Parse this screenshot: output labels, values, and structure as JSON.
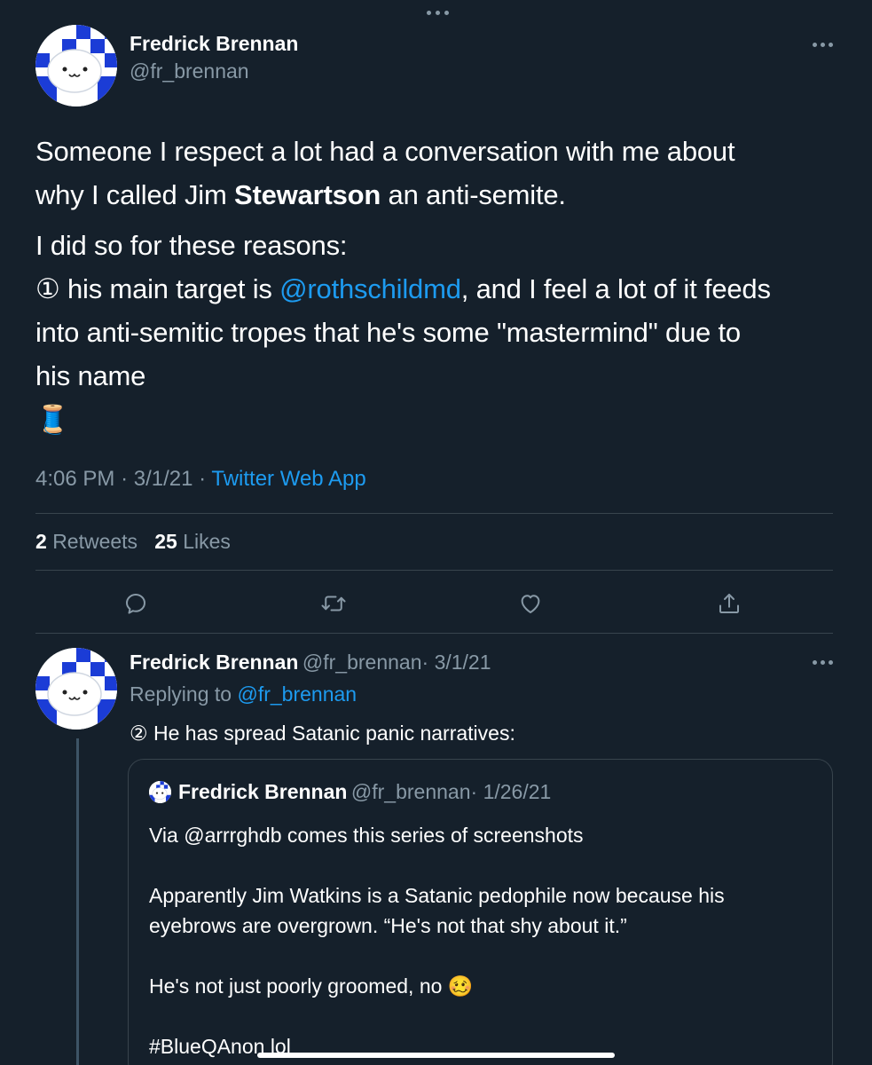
{
  "main_tweet": {
    "author_name": "Fredrick Brennan",
    "author_handle": "@fr_brennan",
    "line1": "Someone I respect a lot had a conversation with me about",
    "line2_pre": "why I called Jim ",
    "line2_bold": "Stewartson",
    "line2_post": " an anti-semite.",
    "para2_line1": "I did so for these reasons:",
    "para2_line2_pre": "① his main target is ",
    "para2_mention": "@rothschildmd",
    "para2_line2_post": ", and I feel a lot of it feeds",
    "para2_line3": "into anti-semitic tropes that he's some \"mastermind\" due to",
    "para2_line4": "his name",
    "thread_emoji": "🧵",
    "time": "4:06 PM",
    "date": "3/1/21",
    "separator": "·",
    "source": "Twitter Web App",
    "retweets_count": "2",
    "retweets_label": "Retweets",
    "likes_count": "25",
    "likes_label": "Likes"
  },
  "actions": {
    "reply_icon": "reply-icon",
    "retweet_icon": "retweet-icon",
    "like_icon": "heart-icon",
    "share_icon": "share-icon"
  },
  "reply_tweet": {
    "author_name": "Fredrick Brennan",
    "author_handle": "@fr_brennan",
    "date": "· 3/1/21",
    "replying_to_label": "Replying to",
    "replying_to_handle": "@fr_brennan",
    "text": "② He has spread Satanic panic narratives:"
  },
  "quoted_tweet": {
    "author_name": "Fredrick Brennan",
    "author_handle": "@fr_brennan",
    "date": "· 1/26/21",
    "line1": "Via @arrrghdb comes this series of screenshots",
    "line2": "Apparently Jim Watkins is a Satanic pedophile now because his",
    "line3": "eyebrows are overgrown. “He's not that shy about it.”",
    "line4": "He's not just poorly groomed, no 🥴",
    "line5": "#BlueQAnon lol"
  },
  "colors": {
    "background": "#15202b",
    "link": "#1d9bf0",
    "secondary_text": "#8899a6",
    "divider": "#38444d"
  }
}
